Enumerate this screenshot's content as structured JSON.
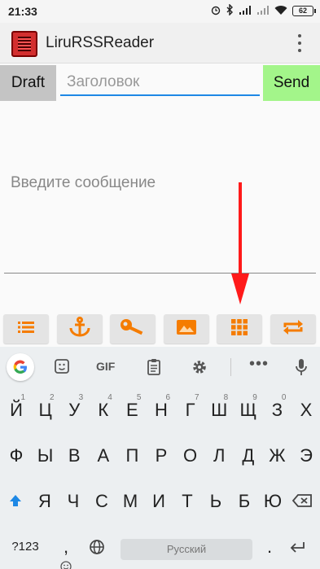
{
  "status_bar": {
    "time": "21:33",
    "battery": "62"
  },
  "app_bar": {
    "title": "LiruRSSReader"
  },
  "compose": {
    "draft_label": "Draft",
    "title_placeholder": "Заголовок",
    "send_label": "Send",
    "message_placeholder": "Введите сообщение"
  },
  "toolbar": {
    "buttons": [
      "list-icon",
      "anchor-icon",
      "key-icon",
      "image-icon",
      "grid-icon",
      "repeat-icon"
    ],
    "accent": "#f57c00"
  },
  "keyboard": {
    "top_bar": {
      "gif_label": "GIF"
    },
    "row1": [
      {
        "k": "Й",
        "h": "1"
      },
      {
        "k": "Ц",
        "h": "2"
      },
      {
        "k": "У",
        "h": "3"
      },
      {
        "k": "К",
        "h": "4"
      },
      {
        "k": "Е",
        "h": "5"
      },
      {
        "k": "Н",
        "h": "6"
      },
      {
        "k": "Г",
        "h": "7"
      },
      {
        "k": "Ш",
        "h": "8"
      },
      {
        "k": "Щ",
        "h": "9"
      },
      {
        "k": "З",
        "h": "0"
      },
      {
        "k": "Х",
        "h": ""
      }
    ],
    "row2": [
      "Ф",
      "Ы",
      "В",
      "А",
      "П",
      "Р",
      "О",
      "Л",
      "Д",
      "Ж",
      "Э"
    ],
    "row3": [
      "Я",
      "Ч",
      "С",
      "М",
      "И",
      "Т",
      "Ь",
      "Б",
      "Ю"
    ],
    "bottom": {
      "symbols": "?123",
      "comma": ",",
      "space": "Русский",
      "period": "."
    }
  }
}
